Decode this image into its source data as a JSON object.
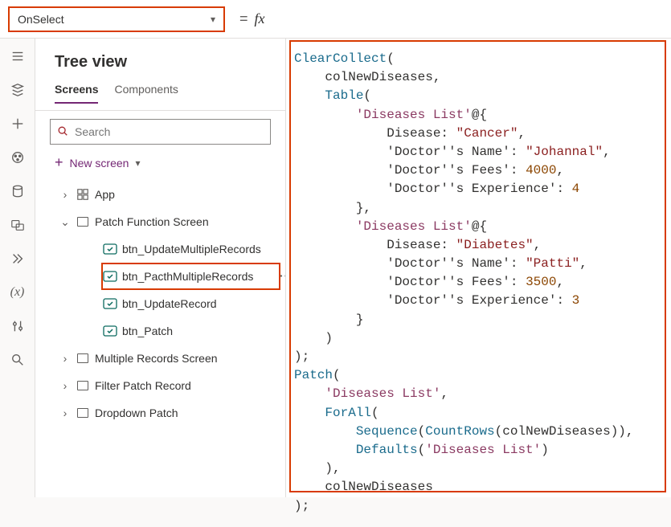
{
  "topbar": {
    "property": "OnSelect",
    "equals": "=",
    "fx": "fx"
  },
  "tree": {
    "title": "Tree view",
    "tabs": {
      "screens": "Screens",
      "components": "Components"
    },
    "search_placeholder": "Search",
    "new_screen": "New screen",
    "items": {
      "app": "App",
      "patch_screen": "Patch Function Screen",
      "btn_update_multi": "btn_UpdateMultipleRecords",
      "btn_patch_multi": "btn_PacthMultipleRecords",
      "btn_update": "btn_UpdateRecord",
      "btn_patch": "btn_Patch",
      "multi_records": "Multiple Records Screen",
      "filter_patch": "Filter Patch Record",
      "dropdown_patch": "Dropdown Patch"
    }
  },
  "code": {
    "fn_clearcollect": "ClearCollect",
    "col_name": "colNewDiseases",
    "fn_table": "Table",
    "ds_name": "'Diseases List'",
    "at": "@",
    "lbrace": "{",
    "rbrace": "}",
    "field_disease": "Disease:",
    "val_cancer": "\"Cancer\"",
    "field_dname": "'Doctor''s Name':",
    "val_johannal": "\"Johannal\"",
    "field_fees": "'Doctor''s Fees':",
    "val_4000": "4000",
    "field_exp": "'Doctor''s Experience':",
    "val_4": "4",
    "val_diabetes": "\"Diabetes\"",
    "val_patti": "\"Patti\"",
    "val_3500": "3500",
    "val_3": "3",
    "fn_patch": "Patch",
    "fn_forall": "ForAll",
    "fn_sequence": "Sequence",
    "fn_countrows": "CountRows",
    "fn_defaults": "Defaults",
    "close_paren_semi": ");",
    "close_paren": ")",
    "comma": ","
  }
}
